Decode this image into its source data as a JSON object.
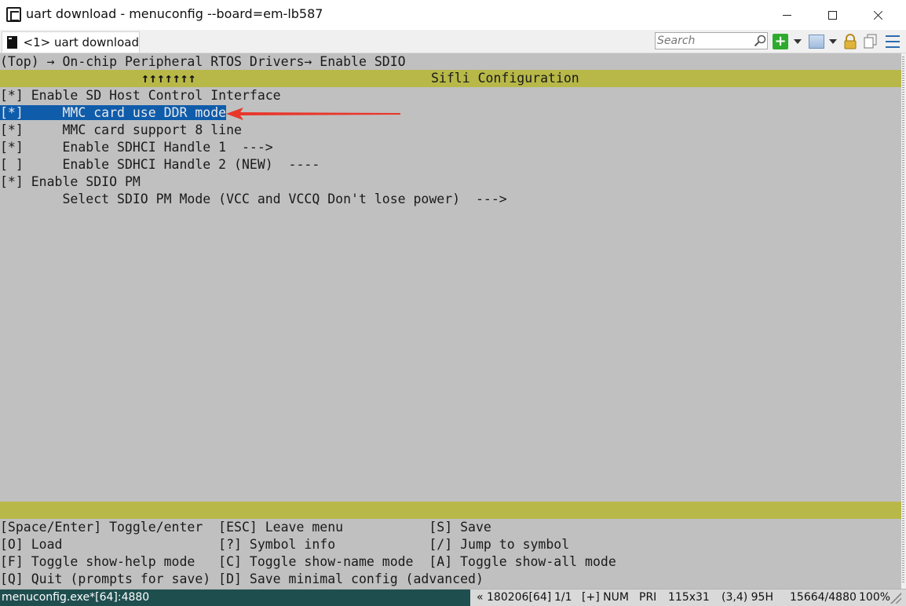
{
  "window": {
    "title": "uart download - menuconfig  --board=em-lb587"
  },
  "tab": {
    "label": "<1> uart download"
  },
  "search": {
    "placeholder": "Search"
  },
  "terminal": {
    "breadcrumb": "(Top) → On-chip Peripheral RTOS Drivers→ Enable SDIO",
    "scroll_arrows": "↑↑↑↑↑↑↑",
    "config_title": "Sifli Configuration",
    "items": [
      {
        "text": "[*] Enable SD Host Control Interface"
      },
      {
        "text": "[*]     MMC card use DDR mode",
        "selected": true
      },
      {
        "text": "[*]     MMC card support 8 line"
      },
      {
        "text": "[*]     Enable SDHCI Handle 1  --->"
      },
      {
        "text": "[ ]     Enable SDHCI Handle 2 (NEW)  ----"
      },
      {
        "text": "[*] Enable SDIO PM"
      },
      {
        "text": "        Select SDIO PM Mode (VCC and VCCQ Don't lose power)  --->"
      }
    ],
    "help_lines": [
      "[Space/Enter] Toggle/enter  [ESC] Leave menu           [S] Save",
      "[O] Load                    [?] Symbol info            [/] Jump to symbol",
      "[F] Toggle show-help mode   [C] Toggle show-name mode  [A] Toggle show-all mode",
      "[Q] Quit (prompts for save) [D] Save minimal config (advanced)"
    ]
  },
  "statusbar": {
    "process": "menuconfig.exe*[64]:4880",
    "position": "« 180206[64]",
    "fraction": "1/1",
    "num": "[+] NUM",
    "pri": "PRI",
    "size": "115x31",
    "cursor": "(3,4) 95H",
    "memory": "15664/4880",
    "zoom": "100%"
  },
  "colors": {
    "terminal_bg": "#c0c0c0",
    "bar_bg": "#b8b849",
    "selection_bg": "#0f5cab",
    "annotation_arrow": "#e8362a"
  }
}
